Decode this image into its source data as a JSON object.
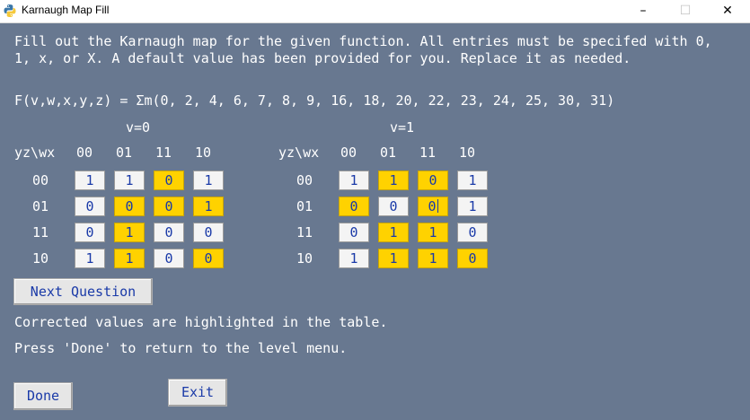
{
  "window": {
    "title": "Karnaugh Map Fill",
    "minimize": "–",
    "maximize": "☐",
    "close": "✕"
  },
  "instructions": "Fill out the Karnaugh map for the given function. All entries must be specifed with 0, 1, x, or X. A default value has been provided for you. Replace it as needed.",
  "function": "F(v,w,x,y,z) = Σm(0, 2, 4, 6, 7, 8, 9, 16, 18, 20, 22, 23, 24, 25, 30, 31)",
  "maps": [
    {
      "title": "v=0",
      "corner": "yz\\wx",
      "cols": [
        "00",
        "01",
        "11",
        "10"
      ],
      "rows": [
        {
          "label": "00",
          "cells": [
            "1",
            "1",
            "0",
            "1"
          ],
          "corrected": [
            false,
            false,
            true,
            false
          ]
        },
        {
          "label": "01",
          "cells": [
            "0",
            "0",
            "0",
            "1"
          ],
          "corrected": [
            false,
            true,
            true,
            true
          ]
        },
        {
          "label": "11",
          "cells": [
            "0",
            "1",
            "0",
            "0"
          ],
          "corrected": [
            false,
            true,
            false,
            false
          ]
        },
        {
          "label": "10",
          "cells": [
            "1",
            "1",
            "0",
            "0"
          ],
          "corrected": [
            false,
            true,
            false,
            true
          ]
        }
      ]
    },
    {
      "title": "v=1",
      "corner": "yz\\wx",
      "cols": [
        "00",
        "01",
        "11",
        "10"
      ],
      "rows": [
        {
          "label": "00",
          "cells": [
            "1",
            "1",
            "0",
            "1"
          ],
          "corrected": [
            false,
            true,
            true,
            false
          ]
        },
        {
          "label": "01",
          "cells": [
            "0",
            "0",
            "0",
            "1"
          ],
          "corrected": [
            true,
            false,
            true,
            false
          ]
        },
        {
          "label": "11",
          "cells": [
            "0",
            "1",
            "1",
            "0"
          ],
          "corrected": [
            false,
            true,
            true,
            false
          ]
        },
        {
          "label": "10",
          "cells": [
            "1",
            "1",
            "1",
            "0"
          ],
          "corrected": [
            false,
            true,
            true,
            true
          ]
        }
      ]
    }
  ],
  "next_question_label": "Next Question",
  "status_corrected": "Corrected values are highlighted in the table.",
  "status_done": "Press 'Done' to return to the level menu.",
  "done_label": "Done",
  "exit_label": "Exit",
  "colors": {
    "background": "#687890",
    "corrected": "#ffd200",
    "cell": "#f4f4f4",
    "cell_text": "#1a3aa8"
  },
  "icons": {
    "app": "python-icon"
  }
}
